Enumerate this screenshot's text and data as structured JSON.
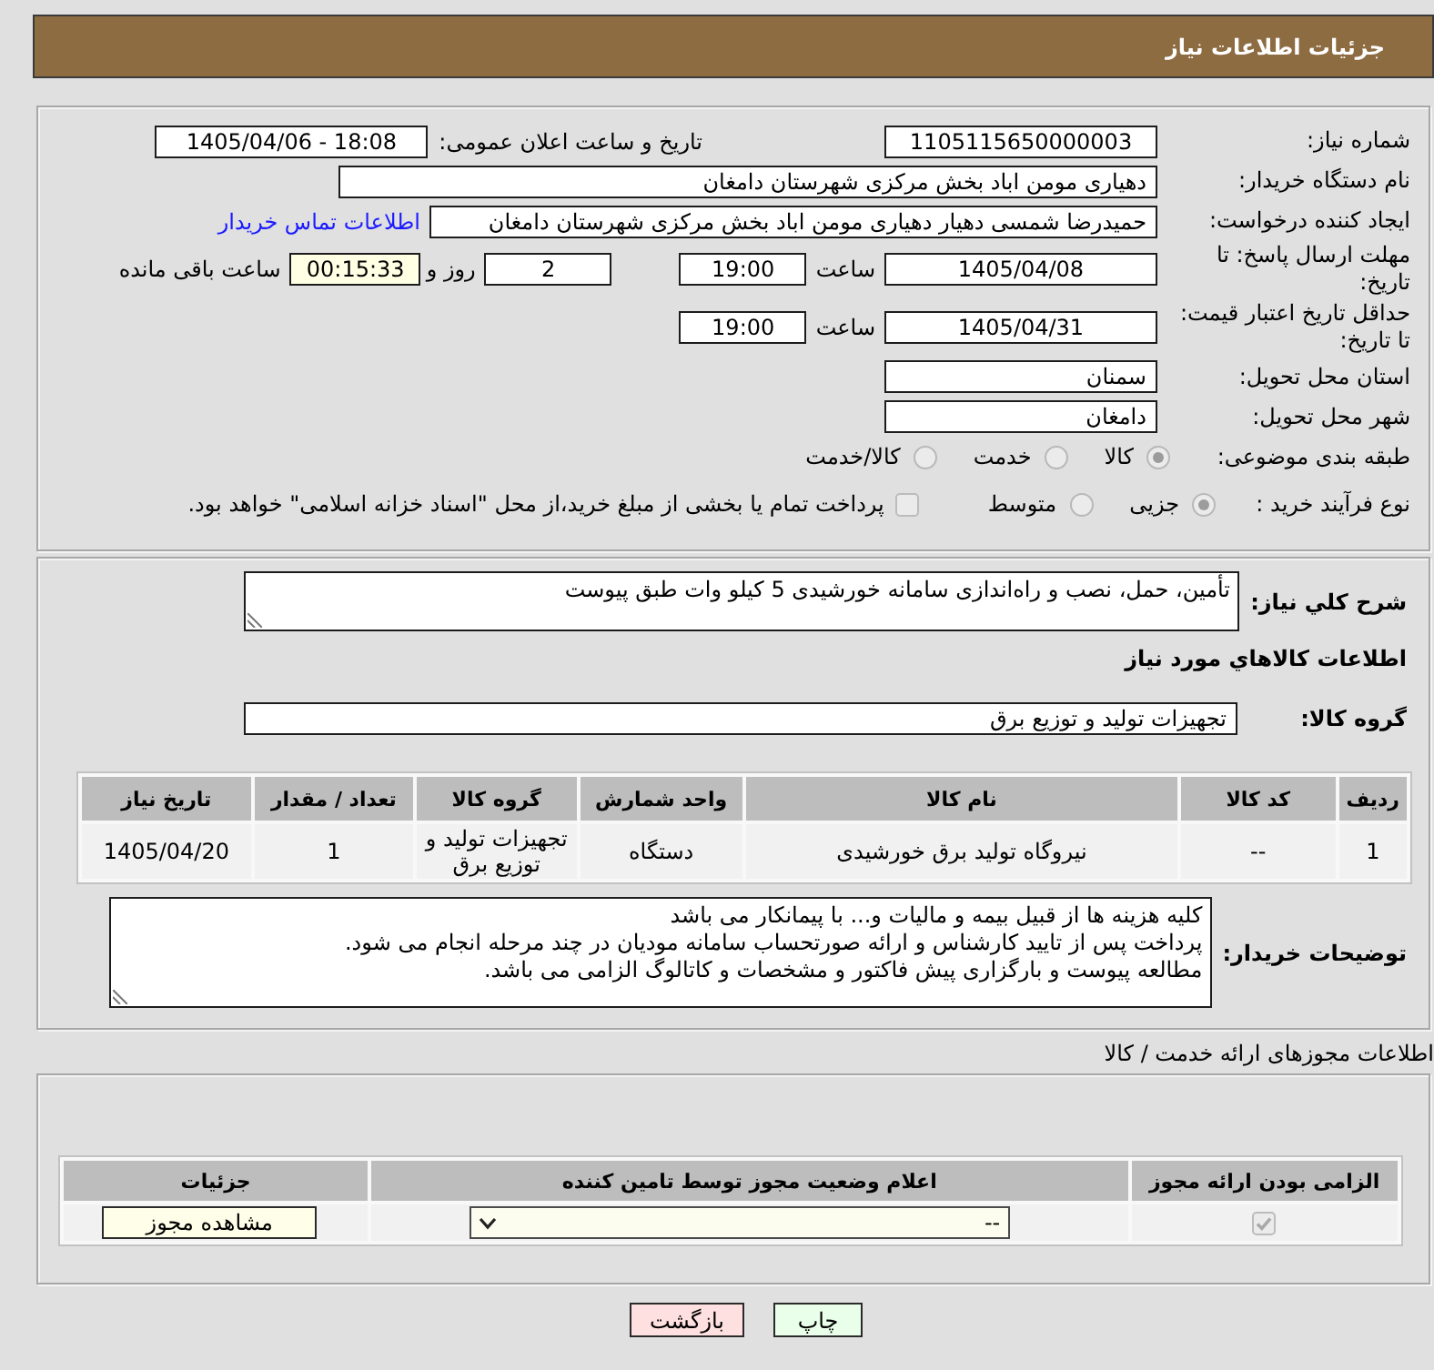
{
  "header": {
    "title": "جزئیات اطلاعات نیاز"
  },
  "details": {
    "need_number": {
      "label": "شماره نیاز:",
      "value": "1105115650000003"
    },
    "announcement": {
      "label": "تاریخ و ساعت اعلان عمومی:",
      "value": "1405/04/06 - 18:08"
    },
    "buyer_org": {
      "label": "نام دستگاه خریدار:",
      "value": "دهیاری مومن اباد بخش مرکزی شهرستان دامغان"
    },
    "requester": {
      "label": "ایجاد کننده درخواست:",
      "value": "حمیدرضا شمسی دهیار دهیاری مومن اباد بخش مرکزی شهرستان دامغان",
      "link": "اطلاعات تماس خریدار"
    },
    "reply_deadline": {
      "label": "مهلت ارسال پاسخ: تا تاریخ:",
      "date": "1405/04/08",
      "time_label": "ساعت",
      "time": "19:00",
      "days": "2",
      "days_label": "روز و",
      "remaining": "00:15:33",
      "remaining_label": "ساعت باقی مانده"
    },
    "price_validity": {
      "label": "حداقل تاریخ اعتبار قیمت: تا تاریخ:",
      "date": "1405/04/31",
      "time_label": "ساعت",
      "time": "19:00"
    },
    "province": {
      "label": "استان محل تحویل:",
      "value": "سمنان"
    },
    "city": {
      "label": "شهر محل تحویل:",
      "value": "دامغان"
    },
    "category": {
      "label": "طبقه بندی موضوعی:",
      "disabled": true,
      "options": [
        {
          "label": "کالا",
          "selected": true
        },
        {
          "label": "خدمت",
          "selected": false
        },
        {
          "label": "کالا/خدمت",
          "selected": false
        }
      ]
    },
    "purchase_process": {
      "label": "نوع فرآیند خرید :",
      "disabled": true,
      "options": [
        {
          "label": "جزیی",
          "selected": true
        },
        {
          "label": "متوسط",
          "selected": false
        }
      ],
      "treasury_payment": {
        "label": "پرداخت تمام یا بخشی از مبلغ خرید،از محل \"اسناد خزانه اسلامی\" خواهد بود.",
        "checked": false,
        "disabled": true
      }
    }
  },
  "requirements": {
    "description": {
      "label": "شرح کلي نیاز:",
      "value": "تأمین، حمل، نصب و راه‌اندازی سامانه خورشیدی 5 کیلو وات طبق پیوست"
    },
    "goods_heading": "اطلاعات کالاهاي مورد نیاز",
    "goods_group": {
      "label": "گروه کالا:",
      "value": "تجهیزات تولید و توزیع برق"
    },
    "table": {
      "columns": [
        "ردیف",
        "کد کالا",
        "نام کالا",
        "واحد شمارش",
        "گروه کالا",
        "تعداد / مقدار",
        "تاریخ نیاز"
      ],
      "rows": [
        [
          "1",
          "--",
          "نیروگاه تولید برق خورشیدی",
          "دستگاه",
          "تجهیزات تولید و توزیع برق",
          "1",
          "1405/04/20"
        ]
      ]
    },
    "buyer_notes": {
      "label": "توضیحات خریدار:",
      "lines": [
        "کلیه هزینه ها از قبیل بیمه و مالیات و... با پیمانکار می باشد",
        "پرداخت پس از تایید کارشناس و ارائه صورتحساب سامانه مودیان در چند مرحله انجام می شود.",
        "مطالعه پیوست و بارگزاری پیش فاکتور و مشخصات و کاتالوگ الزامی می باشد."
      ]
    }
  },
  "permits": {
    "title": "اطلاعات مجوزهای ارائه خدمت / کالا",
    "columns": [
      "الزامی بودن ارائه مجوز",
      "اعلام وضعیت مجوز توسط تامین کننده",
      "جزئیات"
    ],
    "rows": [
      {
        "required": {
          "checked": true,
          "disabled": true
        },
        "status": "--",
        "details_button": "مشاهده مجوز"
      }
    ]
  },
  "buttons": [
    {
      "label": "چاپ",
      "kind": "print"
    },
    {
      "label": "بازگشت",
      "kind": "back"
    }
  ]
}
